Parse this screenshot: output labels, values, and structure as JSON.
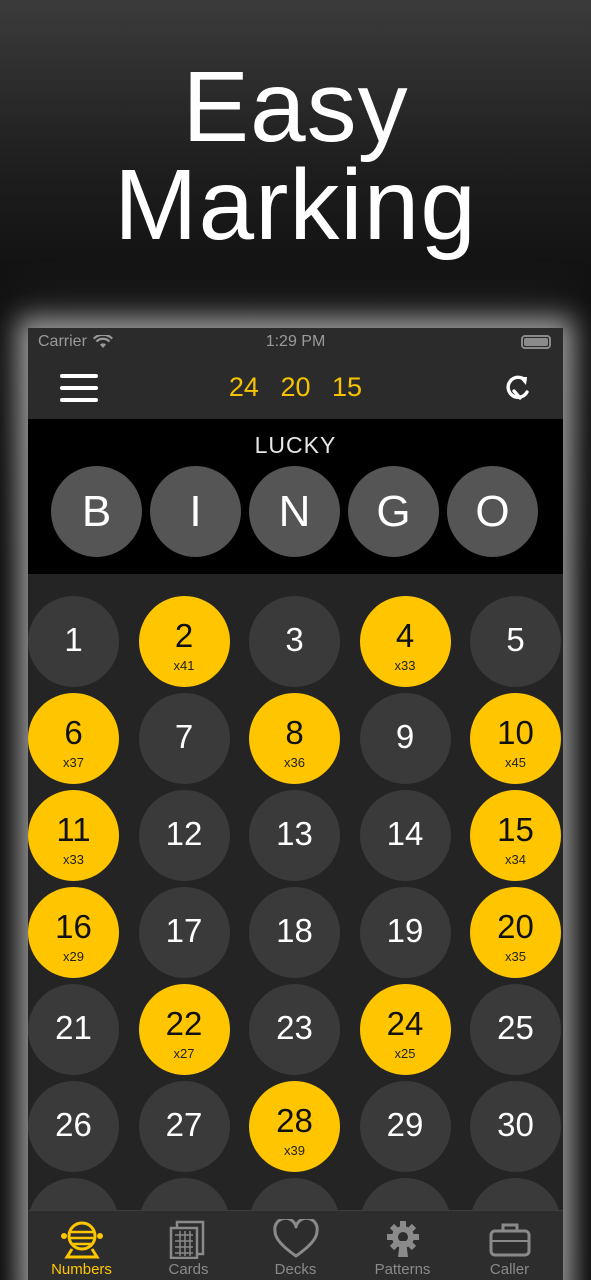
{
  "promo": {
    "headline_line1": "Easy",
    "headline_line2": "Marking"
  },
  "status_bar": {
    "carrier": "Carrier",
    "time": "1:29 PM"
  },
  "toolbar": {
    "called_numbers": [
      "24",
      "20",
      "15"
    ],
    "menu_icon": "hamburger-menu-icon",
    "refresh_icon": "refresh-icon"
  },
  "header": {
    "title": "LUCKY",
    "letters": [
      "B",
      "I",
      "N",
      "G",
      "O"
    ]
  },
  "balls": [
    {
      "number": "1",
      "marked": false,
      "multiplier": ""
    },
    {
      "number": "2",
      "marked": true,
      "multiplier": "x41"
    },
    {
      "number": "3",
      "marked": false,
      "multiplier": ""
    },
    {
      "number": "4",
      "marked": true,
      "multiplier": "x33"
    },
    {
      "number": "5",
      "marked": false,
      "multiplier": ""
    },
    {
      "number": "6",
      "marked": true,
      "multiplier": "x37"
    },
    {
      "number": "7",
      "marked": false,
      "multiplier": ""
    },
    {
      "number": "8",
      "marked": true,
      "multiplier": "x36"
    },
    {
      "number": "9",
      "marked": false,
      "multiplier": ""
    },
    {
      "number": "10",
      "marked": true,
      "multiplier": "x45"
    },
    {
      "number": "11",
      "marked": true,
      "multiplier": "x33"
    },
    {
      "number": "12",
      "marked": false,
      "multiplier": ""
    },
    {
      "number": "13",
      "marked": false,
      "multiplier": ""
    },
    {
      "number": "14",
      "marked": false,
      "multiplier": ""
    },
    {
      "number": "15",
      "marked": true,
      "multiplier": "x34"
    },
    {
      "number": "16",
      "marked": true,
      "multiplier": "x29"
    },
    {
      "number": "17",
      "marked": false,
      "multiplier": ""
    },
    {
      "number": "18",
      "marked": false,
      "multiplier": ""
    },
    {
      "number": "19",
      "marked": false,
      "multiplier": ""
    },
    {
      "number": "20",
      "marked": true,
      "multiplier": "x35"
    },
    {
      "number": "21",
      "marked": false,
      "multiplier": ""
    },
    {
      "number": "22",
      "marked": true,
      "multiplier": "x27"
    },
    {
      "number": "23",
      "marked": false,
      "multiplier": ""
    },
    {
      "number": "24",
      "marked": true,
      "multiplier": "x25"
    },
    {
      "number": "25",
      "marked": false,
      "multiplier": ""
    },
    {
      "number": "26",
      "marked": false,
      "multiplier": ""
    },
    {
      "number": "27",
      "marked": false,
      "multiplier": ""
    },
    {
      "number": "28",
      "marked": true,
      "multiplier": "x39"
    },
    {
      "number": "29",
      "marked": false,
      "multiplier": ""
    },
    {
      "number": "30",
      "marked": false,
      "multiplier": ""
    },
    {
      "number": "",
      "marked": false,
      "multiplier": ""
    },
    {
      "number": "",
      "marked": false,
      "multiplier": ""
    },
    {
      "number": "",
      "marked": false,
      "multiplier": ""
    },
    {
      "number": "",
      "marked": false,
      "multiplier": ""
    },
    {
      "number": "",
      "marked": false,
      "multiplier": ""
    }
  ],
  "tabs": [
    {
      "label": "Numbers",
      "icon": "bingo-cage-icon",
      "active": true
    },
    {
      "label": "Cards",
      "icon": "bingo-card-icon",
      "active": false
    },
    {
      "label": "Decks",
      "icon": "heart-icon",
      "active": false
    },
    {
      "label": "Patterns",
      "icon": "gear-wrench-icon",
      "active": false
    },
    {
      "label": "Caller",
      "icon": "briefcase-icon",
      "active": false
    }
  ],
  "colors": {
    "accent": "#ffc600",
    "called_text": "#f7c300",
    "unmarked_ball": "#3a3a3a",
    "letter_ball": "#555555",
    "tab_inactive": "#8a8a8a"
  }
}
